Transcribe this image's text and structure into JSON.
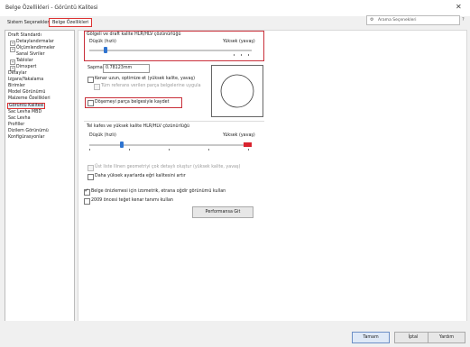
{
  "window": {
    "title": "Belge Özellikleri - Görüntü Kalitesi",
    "close_glyph": "✕"
  },
  "tabs": [
    {
      "label": "Sistem Seçenekleri"
    },
    {
      "label": "Belge Özellikleri"
    }
  ],
  "search": {
    "placeholder": "Arama Seçenekleri",
    "icon": "gear-icon"
  },
  "help_glyph": "?",
  "tree": {
    "items": [
      {
        "label": "Drafting Standardı",
        "display": "Draft Standardı"
      },
      {
        "label": "Detaylandırmalar"
      },
      {
        "label": "Ölçümlendirmeler"
      },
      {
        "label": "Sanal Sivriler"
      },
      {
        "label": "Tablolar"
      },
      {
        "label": "Dimxpert"
      },
      {
        "label": "Detaylar"
      },
      {
        "label": "Izgara/Yakalama"
      },
      {
        "label": "Birimler"
      },
      {
        "label": "Model Görünümü"
      },
      {
        "label": "Malzeme Özellikleri"
      },
      {
        "label": "Görüntü Kalitesi"
      },
      {
        "label": "Sac Levha MBD"
      },
      {
        "label": "Sac Levha"
      },
      {
        "label": "Profiller"
      },
      {
        "label": "Dizilem Görünümü"
      },
      {
        "label": "Konfigürasyonlar"
      }
    ]
  },
  "shaded": {
    "heading": "Gölgeli ve draft kalite HLR/HLV çözünürlüğü",
    "low": "Düşük (hızlı)",
    "high": "Yüksek (yavaş)",
    "level": 0.1
  },
  "deviation": {
    "label": "Sapma:",
    "value": "0.78123mm"
  },
  "options1": [
    {
      "label": "Kenar uzun, optimize et (yüksek kalite, yavaş)",
      "checked": false,
      "disabled": false
    },
    {
      "label": "Tüm referans verilen parça belgelerine uygula",
      "checked": false,
      "disabled": true
    },
    {
      "label": "Döşemeyi parça belgesiyle kaydet",
      "checked": false,
      "disabled": false
    }
  ],
  "wireframe": {
    "heading": "Tel kafes ve yüksek kalite HLR/HLV çözünürlüğü",
    "low": "Düşük (hızlı)",
    "high": "Yüksek (yavaş)",
    "level": 0.2
  },
  "options2": [
    {
      "label": "Üst liste Ilinen geometriyi çok detaylı oluştur (yüksek kalite, yavaş)",
      "checked": false,
      "disabled": true
    },
    {
      "label": "Daha yüksek ayarlarda eğri kalitesini artır",
      "checked": false,
      "disabled": false
    }
  ],
  "options3": [
    {
      "label": "Belge önizlemesi için izometrik, etrana oğdir görünümü kullan",
      "checked": true
    },
    {
      "label": "2009 öncesi teğet kenar tanımı kullan",
      "checked": false
    }
  ],
  "performance_button": "Performansa Git",
  "footer": {
    "ok": "Tamam",
    "cancel": "İptal",
    "help": "Yardım"
  }
}
